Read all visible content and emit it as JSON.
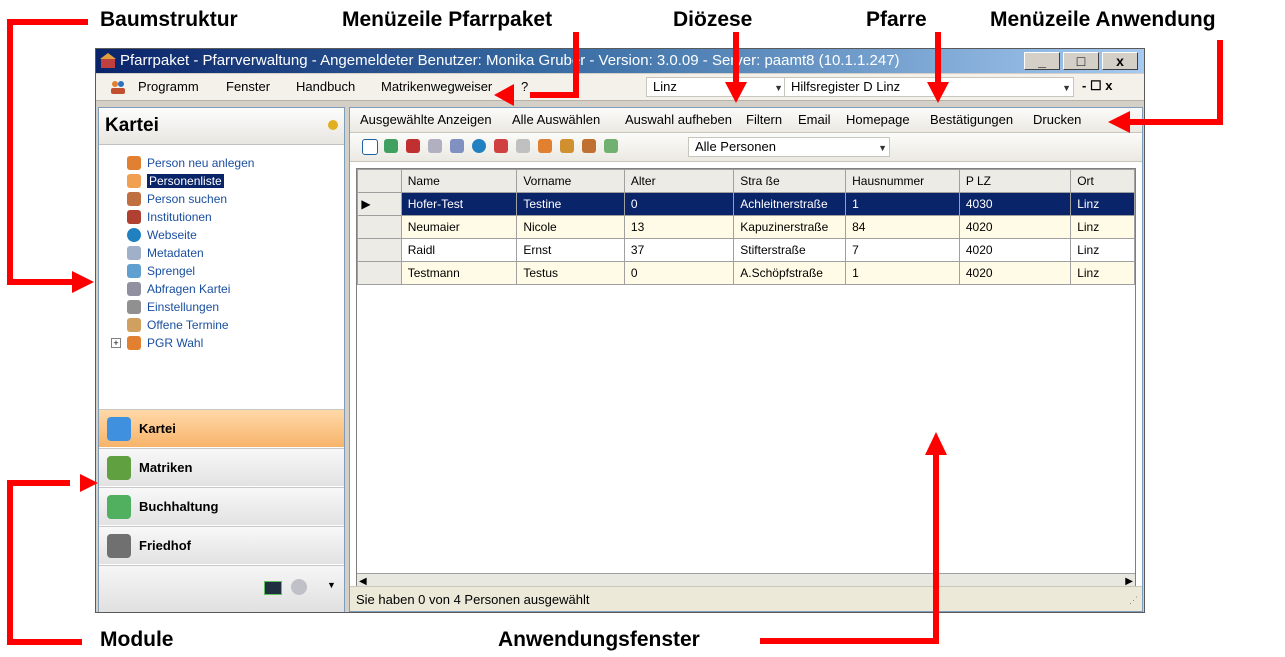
{
  "annotations": {
    "baumstruktur": "Baumstruktur",
    "menue_pfarrpaket": "Menüzeile Pfarrpaket",
    "dioezese": "Diözese",
    "pfarre": "Pfarre",
    "menue_anwendung": "Menüzeile Anwendung",
    "module": "Module",
    "anwendungsfenster": "Anwendungsfenster",
    "arrow_color": "#ff0000"
  },
  "window": {
    "title": "Pfarrpaket - Pfarrverwaltung - Angemeldeter Benutzer: Monika Gruber - Version: 3.0.09 - Server: paamt8 (10.1.1.247)",
    "minimize": "_",
    "maximize": "□",
    "close": "x"
  },
  "menubar": {
    "items": [
      "Programm",
      "Fenster",
      "Handbuch",
      "Matrikenwegweiser",
      "?"
    ],
    "diocese": "Linz",
    "parish": "Hilfsregister D Linz",
    "mdi_controls": "- ☐ x"
  },
  "left_panel": {
    "title": "Kartei",
    "tree": [
      {
        "label": "Person neu anlegen",
        "icon": "person-add-icon"
      },
      {
        "label": "Personenliste",
        "icon": "list-icon",
        "selected": true
      },
      {
        "label": "Person suchen",
        "icon": "person-search-icon"
      },
      {
        "label": "Institutionen",
        "icon": "institution-icon"
      },
      {
        "label": "Webseite",
        "icon": "globe-icon"
      },
      {
        "label": "Metadaten",
        "icon": "metadata-icon"
      },
      {
        "label": "Sprengel",
        "icon": "map-icon"
      },
      {
        "label": "Abfragen Kartei",
        "icon": "query-icon"
      },
      {
        "label": "Einstellungen",
        "icon": "wrench-icon"
      },
      {
        "label": "Offene Termine",
        "icon": "calendar-icon"
      },
      {
        "label": "PGR Wahl",
        "icon": "group-icon"
      }
    ],
    "modules": [
      {
        "label": "Kartei",
        "active": true,
        "icon": "kartei-icon"
      },
      {
        "label": "Matriken",
        "icon": "books-icon"
      },
      {
        "label": "Buchhaltung",
        "icon": "accounting-icon"
      },
      {
        "label": "Friedhof",
        "icon": "cemetery-icon"
      }
    ]
  },
  "app_menu": {
    "items": [
      "Ausgewählte Anzeigen",
      "Alle Auswählen",
      "Auswahl aufheben",
      "Filtern",
      "Email",
      "Homepage",
      "Bestätigungen",
      "Drucken"
    ]
  },
  "toolbar": {
    "filter_value": "Alle Personen"
  },
  "table": {
    "columns": [
      "Name",
      "Vorname",
      "Alter",
      "Stra ße",
      "Hausnummer",
      "P LZ",
      "Ort"
    ],
    "rows": [
      [
        "Hofer-Test",
        "Testine",
        "0",
        "Achleitnerstraße",
        "1",
        "4030",
        "Linz"
      ],
      [
        "Neumaier",
        "Nicole",
        "13",
        "Kapuzinerstraße",
        "84",
        "4020",
        "Linz"
      ],
      [
        "Raidl",
        "Ernst",
        "37",
        "Stifterstraße",
        "7",
        "4020",
        "Linz"
      ],
      [
        "Testmann",
        "Testus",
        "0",
        "A.Schöpfstraße",
        "1",
        "4020",
        "Linz"
      ]
    ]
  },
  "status": {
    "text": "Sie haben 0 von 4 Personen ausgewählt"
  }
}
